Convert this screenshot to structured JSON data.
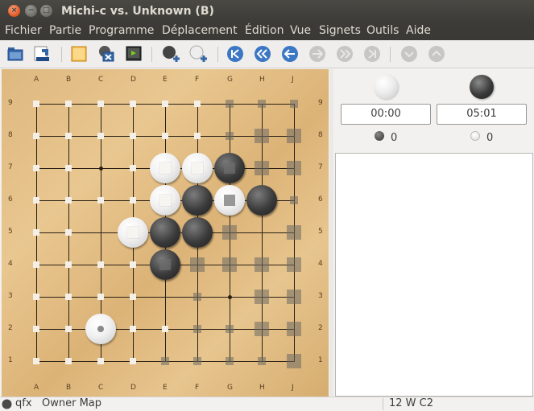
{
  "window": {
    "title": "Michi-c vs. Unknown (B)"
  },
  "menu": [
    "Fichier",
    "Partie",
    "Programme",
    "Déplacement",
    "Édition",
    "Vue",
    "Signets",
    "Outils",
    "Aide"
  ],
  "toolbar": {
    "buttons": [
      "open-file-icon",
      "save-file-icon",
      "new-game-icon",
      "close-game-icon",
      "show-output-icon",
      "add-black-stone-icon",
      "add-white-stone-icon",
      "go-first-icon",
      "go-back-ten-icon",
      "go-back-icon",
      "go-forward-icon",
      "go-forward-ten-icon",
      "go-last-icon",
      "previous-variation-icon",
      "next-variation-icon"
    ]
  },
  "board": {
    "size": 9,
    "columns": [
      "A",
      "B",
      "C",
      "D",
      "E",
      "F",
      "G",
      "H",
      "J"
    ],
    "rows": [
      "9",
      "8",
      "7",
      "6",
      "5",
      "4",
      "3",
      "2",
      "1"
    ],
    "black_stones": [
      "G7",
      "F6",
      "H6",
      "E5",
      "F5",
      "E4"
    ],
    "white_stones": [
      "E7",
      "F7",
      "E6",
      "G6",
      "D5",
      "C2"
    ],
    "last_move": "C2",
    "white_marks": [
      "A9",
      "B9",
      "C9",
      "D9",
      "E9",
      "F9",
      "A8",
      "B8",
      "C8",
      "D8",
      "E8",
      "F8",
      "A7",
      "B7",
      "D7",
      "A6",
      "B6",
      "C6",
      "D6",
      "A5",
      "B5",
      "A4",
      "B4",
      "C4",
      "D4",
      "A3",
      "B3",
      "C3",
      "D3",
      "A2",
      "B2",
      "D2",
      "E2",
      "A1",
      "B1",
      "C1",
      "D1"
    ],
    "black_territory_large": [
      "H8",
      "J8",
      "H7",
      "J7",
      "G5",
      "J5",
      "F4",
      "G4",
      "H4",
      "J4",
      "H3",
      "J3",
      "H2",
      "J2",
      "J1"
    ],
    "black_territory_small": [
      "G9",
      "H9",
      "J9",
      "G8",
      "J6",
      "F3",
      "F2",
      "G2",
      "E1",
      "F1",
      "G1",
      "H1"
    ],
    "colors": {
      "board_light": "#e9c790",
      "board_dark": "#d6ad70",
      "line": "#2a2015"
    }
  },
  "players": {
    "white": {
      "time": "00:00",
      "captures": "0"
    },
    "black": {
      "time": "05:01",
      "captures": "0"
    }
  },
  "comment": "",
  "statusbar": {
    "label": "qfx",
    "mode": "Owner Map",
    "move_info": "12 W C2"
  }
}
